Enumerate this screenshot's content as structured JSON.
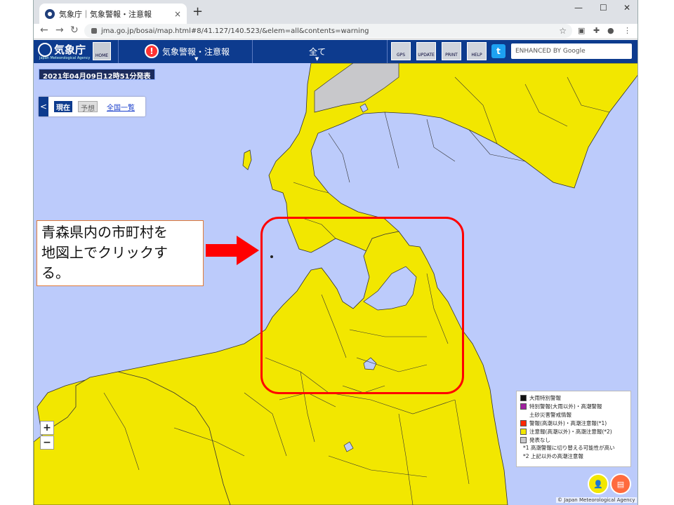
{
  "browser": {
    "tab_title": "気象庁｜気象警報・注意報",
    "url": "jma.go.jp/bosai/map.html#8/41.127/140.523/&elem=all&contents=warning",
    "new_tab": "+",
    "tab_close": "×",
    "minimize": "—",
    "maximize": "☐",
    "close": "✕"
  },
  "jma": {
    "logo_text": "気象庁",
    "logo_sub": "Japan Meteorological Agency",
    "home_label": "HOME",
    "warning_menu": "気象警報・注意報",
    "area_menu": "全て",
    "tools": [
      "GPS",
      "UPDATE",
      "PRINT",
      "HELP"
    ],
    "search_placeholder": "ENHANCED BY Google"
  },
  "map": {
    "issued": "2021年04月09日12時51分発表",
    "panel": {
      "collapse": "<",
      "current": "現在",
      "forecast": "予想",
      "list": "全国一覧"
    },
    "zoom_in": "+",
    "zoom_out": "−",
    "copyright": "© Japan Meteorological Agency",
    "legend": {
      "items": [
        {
          "color": "#111111",
          "label": "大雨特別警報"
        },
        {
          "color": "#a020a0",
          "label": "特別警報(大雨以外)・高潮警報"
        },
        {
          "color": "",
          "label": "土砂災害警戒情報"
        },
        {
          "color": "#ff2800",
          "label": "警報(高潮以外)・高潮注意報(*1)"
        },
        {
          "color": "#f2e700",
          "label": "注意報(高潮以外)・高潮注意報(*2)"
        },
        {
          "color": "#c8c8cb",
          "label": "発表なし"
        }
      ],
      "notes": [
        "*1 高潮警報に切り替える可能性が高い",
        "*2 上記以外の高潮注意報"
      ]
    },
    "colors": {
      "sea": "#bccbfb",
      "advisory": "#f2e700",
      "none": "#c8c8cb"
    }
  },
  "annotation": {
    "callout_lines": [
      "青森県内の市町村を",
      "地図上でクリックす",
      "る。"
    ]
  }
}
